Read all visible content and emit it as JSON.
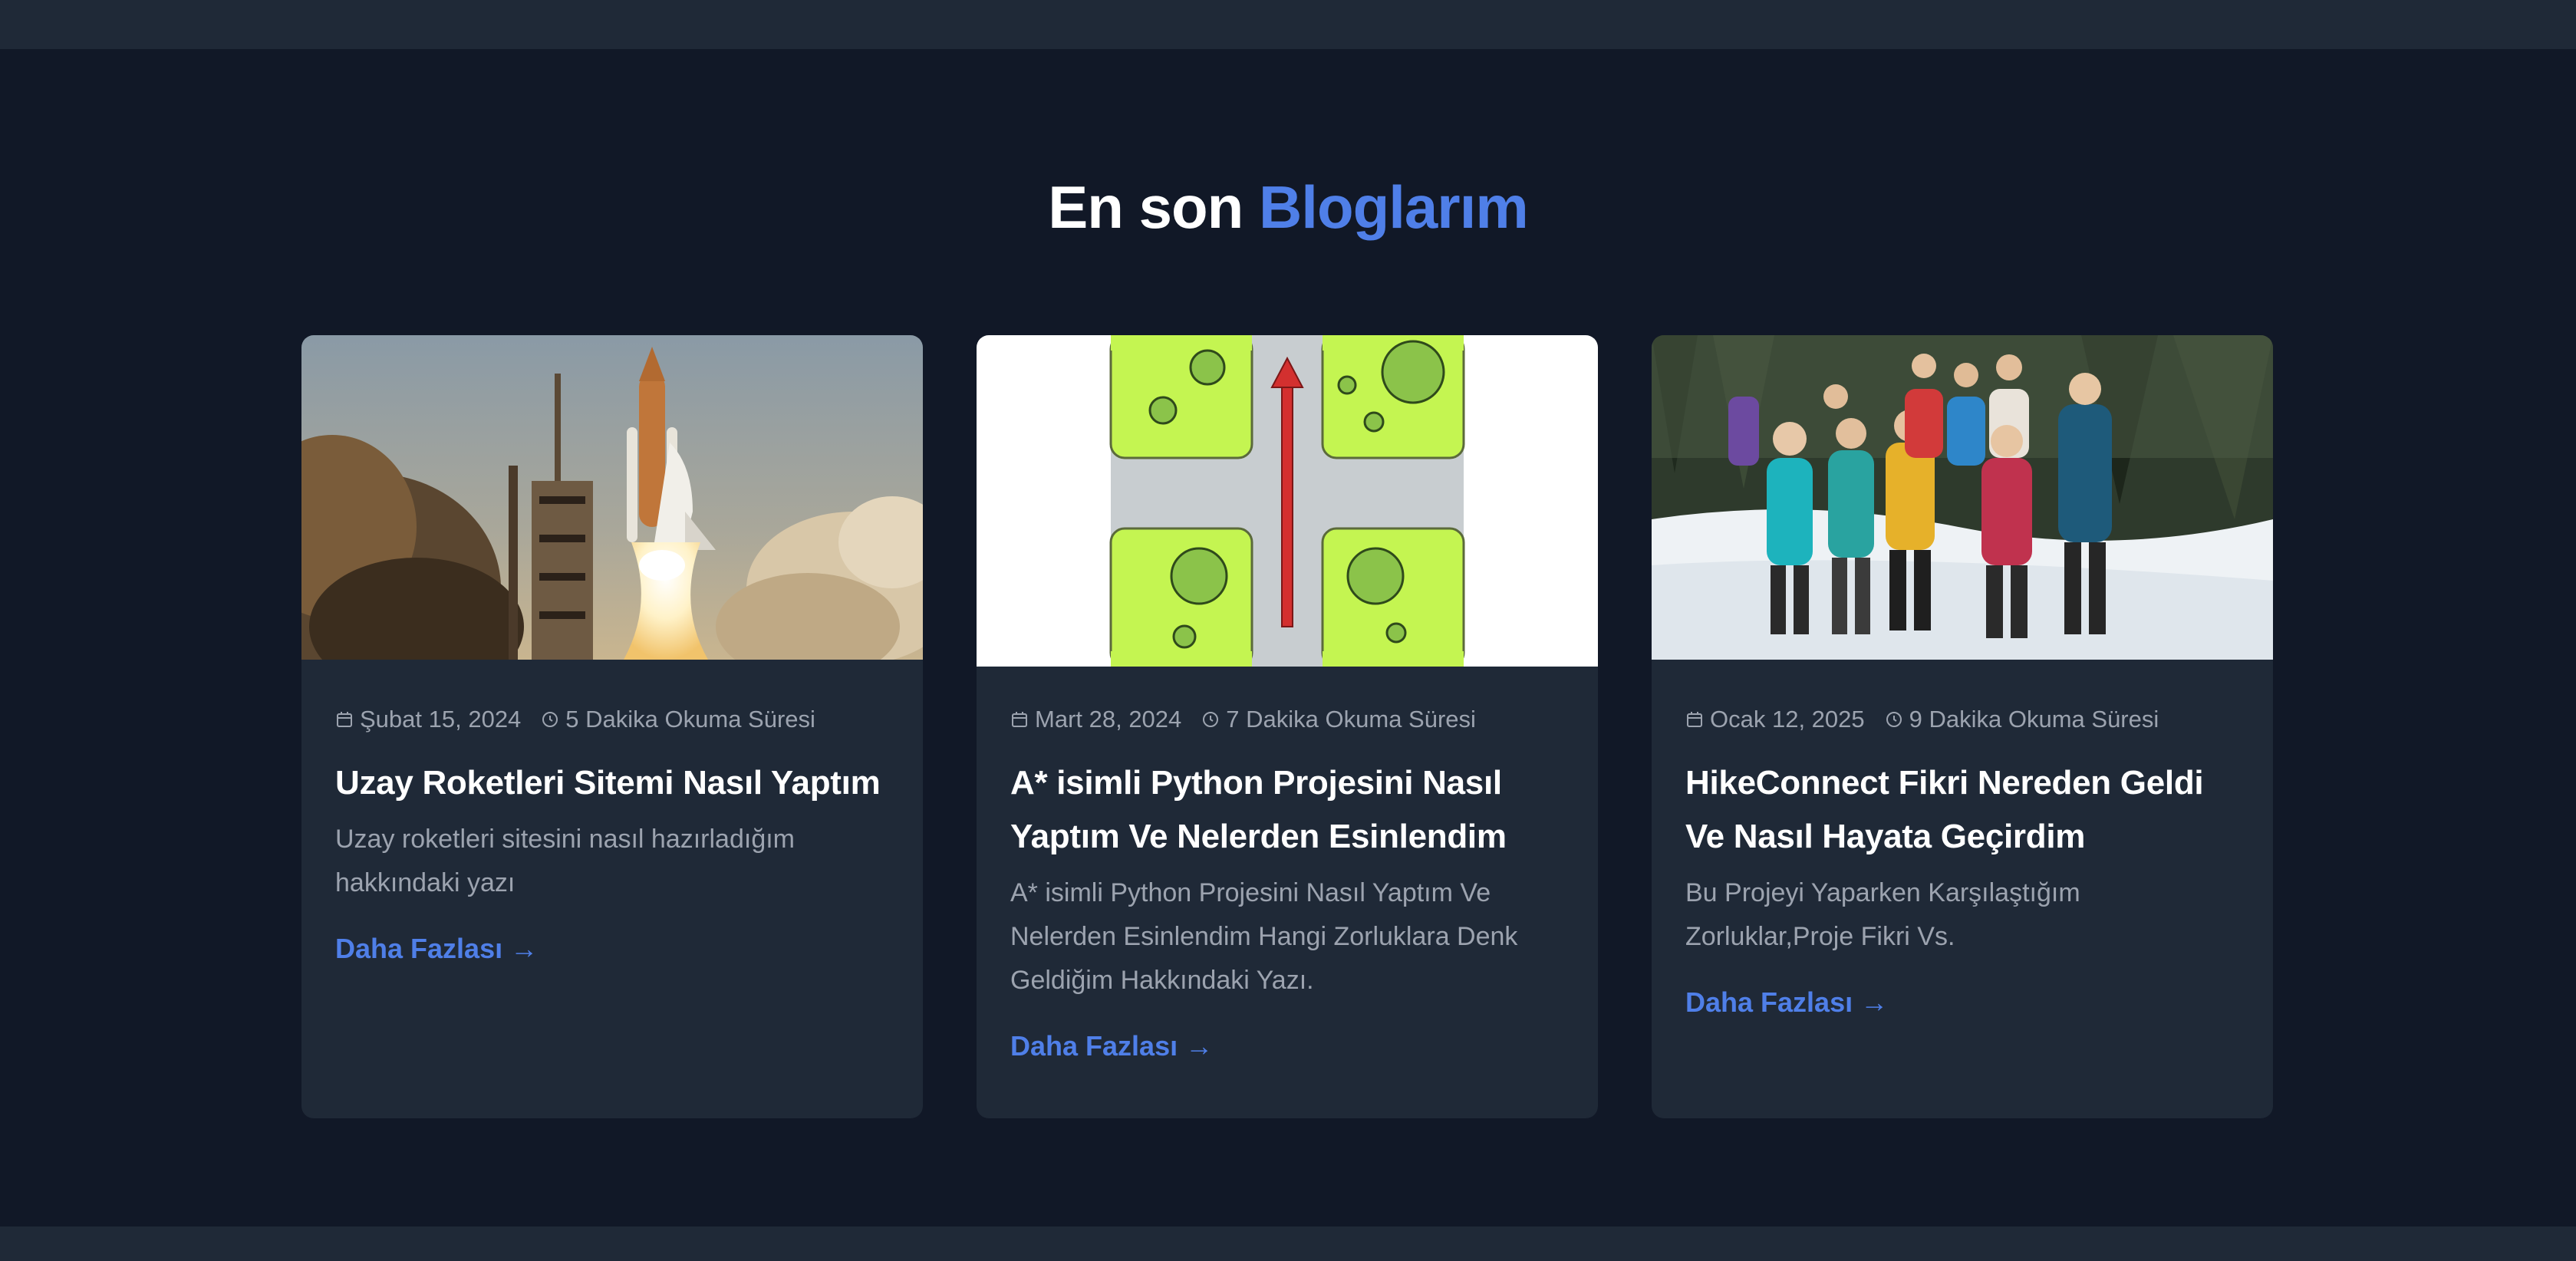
{
  "header": {
    "title_part1": "En son",
    "title_accent": "Bloglarım"
  },
  "colors": {
    "background": "#111827",
    "card": "#1f2937",
    "accent": "#4f7fe8",
    "muted_text": "#9ca3af"
  },
  "posts": [
    {
      "image": "space-shuttle-launch-photo",
      "date": "Şubat 15, 2024",
      "read_time": "5 Dakika Okuma Süresi",
      "title": "Uzay Roketleri Sitemi Nasıl Yaptım",
      "description": "Uzay roketleri sitesini nasıl hazırladığım hakkındaki yazı",
      "link_label": "Daha Fazlası",
      "link_arrow": "→"
    },
    {
      "image": "intersection-pathfinding-illustration",
      "date": "Mart 28, 2024",
      "read_time": "7 Dakika Okuma Süresi",
      "title": "A* isimli Python Projesini Nasıl Yaptım Ve Nelerden Esinlendim",
      "description": "A* isimli Python Projesini Nasıl Yaptım Ve Nelerden Esinlendim Hangi Zorluklara Denk Geldiğim Hakkındaki Yazı.",
      "link_label": "Daha Fazlası",
      "link_arrow": "→"
    },
    {
      "image": "hiking-group-snow-photo",
      "date": "Ocak 12, 2025",
      "read_time": "9 Dakika Okuma Süresi",
      "title": "HikeConnect Fikri Nereden Geldi Ve Nasıl Hayata Geçirdim",
      "description": "Bu Projeyi Yaparken Karşılaştığım Zorluklar,Proje Fikri Vs.",
      "link_label": "Daha Fazlası",
      "link_arrow": "→"
    }
  ],
  "icons": {
    "date": "calendar-icon",
    "read_time": "clock-icon",
    "link": "arrow-right-icon"
  }
}
